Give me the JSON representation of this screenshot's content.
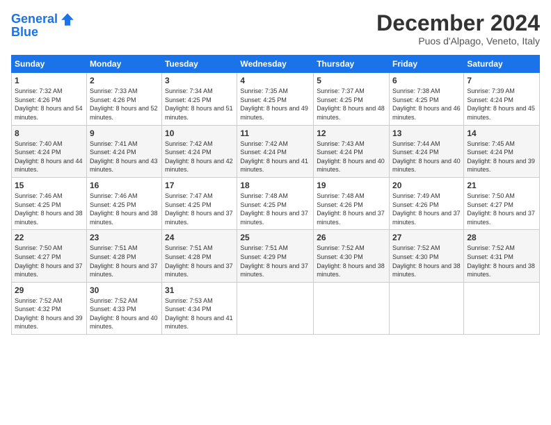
{
  "header": {
    "logo_line1": "General",
    "logo_line2": "Blue",
    "month_year": "December 2024",
    "location": "Puos d'Alpago, Veneto, Italy"
  },
  "weekdays": [
    "Sunday",
    "Monday",
    "Tuesday",
    "Wednesday",
    "Thursday",
    "Friday",
    "Saturday"
  ],
  "weeks": [
    [
      {
        "day": "1",
        "sunrise": "7:32 AM",
        "sunset": "4:26 PM",
        "daylight": "8 hours and 54 minutes."
      },
      {
        "day": "2",
        "sunrise": "7:33 AM",
        "sunset": "4:26 PM",
        "daylight": "8 hours and 52 minutes."
      },
      {
        "day": "3",
        "sunrise": "7:34 AM",
        "sunset": "4:25 PM",
        "daylight": "8 hours and 51 minutes."
      },
      {
        "day": "4",
        "sunrise": "7:35 AM",
        "sunset": "4:25 PM",
        "daylight": "8 hours and 49 minutes."
      },
      {
        "day": "5",
        "sunrise": "7:37 AM",
        "sunset": "4:25 PM",
        "daylight": "8 hours and 48 minutes."
      },
      {
        "day": "6",
        "sunrise": "7:38 AM",
        "sunset": "4:25 PM",
        "daylight": "8 hours and 46 minutes."
      },
      {
        "day": "7",
        "sunrise": "7:39 AM",
        "sunset": "4:24 PM",
        "daylight": "8 hours and 45 minutes."
      }
    ],
    [
      {
        "day": "8",
        "sunrise": "7:40 AM",
        "sunset": "4:24 PM",
        "daylight": "8 hours and 44 minutes."
      },
      {
        "day": "9",
        "sunrise": "7:41 AM",
        "sunset": "4:24 PM",
        "daylight": "8 hours and 43 minutes."
      },
      {
        "day": "10",
        "sunrise": "7:42 AM",
        "sunset": "4:24 PM",
        "daylight": "8 hours and 42 minutes."
      },
      {
        "day": "11",
        "sunrise": "7:42 AM",
        "sunset": "4:24 PM",
        "daylight": "8 hours and 41 minutes."
      },
      {
        "day": "12",
        "sunrise": "7:43 AM",
        "sunset": "4:24 PM",
        "daylight": "8 hours and 40 minutes."
      },
      {
        "day": "13",
        "sunrise": "7:44 AM",
        "sunset": "4:24 PM",
        "daylight": "8 hours and 40 minutes."
      },
      {
        "day": "14",
        "sunrise": "7:45 AM",
        "sunset": "4:24 PM",
        "daylight": "8 hours and 39 minutes."
      }
    ],
    [
      {
        "day": "15",
        "sunrise": "7:46 AM",
        "sunset": "4:25 PM",
        "daylight": "8 hours and 38 minutes."
      },
      {
        "day": "16",
        "sunrise": "7:46 AM",
        "sunset": "4:25 PM",
        "daylight": "8 hours and 38 minutes."
      },
      {
        "day": "17",
        "sunrise": "7:47 AM",
        "sunset": "4:25 PM",
        "daylight": "8 hours and 37 minutes."
      },
      {
        "day": "18",
        "sunrise": "7:48 AM",
        "sunset": "4:25 PM",
        "daylight": "8 hours and 37 minutes."
      },
      {
        "day": "19",
        "sunrise": "7:48 AM",
        "sunset": "4:26 PM",
        "daylight": "8 hours and 37 minutes."
      },
      {
        "day": "20",
        "sunrise": "7:49 AM",
        "sunset": "4:26 PM",
        "daylight": "8 hours and 37 minutes."
      },
      {
        "day": "21",
        "sunrise": "7:50 AM",
        "sunset": "4:27 PM",
        "daylight": "8 hours and 37 minutes."
      }
    ],
    [
      {
        "day": "22",
        "sunrise": "7:50 AM",
        "sunset": "4:27 PM",
        "daylight": "8 hours and 37 minutes."
      },
      {
        "day": "23",
        "sunrise": "7:51 AM",
        "sunset": "4:28 PM",
        "daylight": "8 hours and 37 minutes."
      },
      {
        "day": "24",
        "sunrise": "7:51 AM",
        "sunset": "4:28 PM",
        "daylight": "8 hours and 37 minutes."
      },
      {
        "day": "25",
        "sunrise": "7:51 AM",
        "sunset": "4:29 PM",
        "daylight": "8 hours and 37 minutes."
      },
      {
        "day": "26",
        "sunrise": "7:52 AM",
        "sunset": "4:30 PM",
        "daylight": "8 hours and 38 minutes."
      },
      {
        "day": "27",
        "sunrise": "7:52 AM",
        "sunset": "4:30 PM",
        "daylight": "8 hours and 38 minutes."
      },
      {
        "day": "28",
        "sunrise": "7:52 AM",
        "sunset": "4:31 PM",
        "daylight": "8 hours and 38 minutes."
      }
    ],
    [
      {
        "day": "29",
        "sunrise": "7:52 AM",
        "sunset": "4:32 PM",
        "daylight": "8 hours and 39 minutes."
      },
      {
        "day": "30",
        "sunrise": "7:52 AM",
        "sunset": "4:33 PM",
        "daylight": "8 hours and 40 minutes."
      },
      {
        "day": "31",
        "sunrise": "7:53 AM",
        "sunset": "4:34 PM",
        "daylight": "8 hours and 41 minutes."
      },
      null,
      null,
      null,
      null
    ]
  ]
}
